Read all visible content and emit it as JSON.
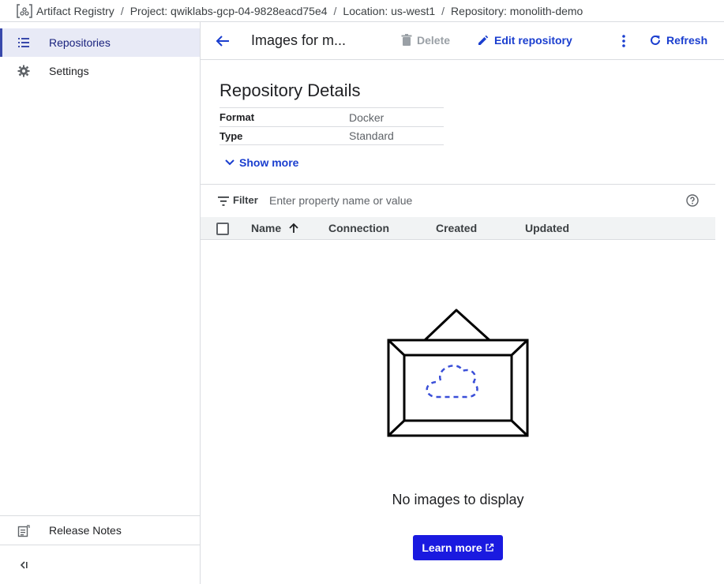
{
  "breadcrumb": {
    "app": "Artifact Registry",
    "project": "Project: qwiklabs-gcp-04-9828eacd75e4",
    "location": "Location: us-west1",
    "repository": "Repository: monolith-demo"
  },
  "sidebar": {
    "items": [
      {
        "label": "Repositories",
        "icon": "list-icon"
      },
      {
        "label": "Settings",
        "icon": "gear-icon"
      }
    ],
    "release_notes": "Release Notes",
    "collapse_icon": "collapse-icon"
  },
  "toolbar": {
    "title": "Images for m...",
    "delete_label": "Delete",
    "edit_label": "Edit repository",
    "refresh_label": "Refresh"
  },
  "details": {
    "title": "Repository Details",
    "rows": [
      {
        "key": "Format",
        "value": "Docker"
      },
      {
        "key": "Type",
        "value": "Standard"
      }
    ],
    "show_more": "Show more"
  },
  "filter": {
    "label": "Filter",
    "placeholder": "Enter property name or value"
  },
  "table": {
    "columns": [
      "Name",
      "Connection",
      "Created",
      "Updated"
    ]
  },
  "empty": {
    "message": "No images to display",
    "button": "Learn more"
  },
  "colors": {
    "accent": "#1a3ecf",
    "button_bg": "#1a1ae0",
    "nav_active_bg": "#e8eaf6"
  }
}
